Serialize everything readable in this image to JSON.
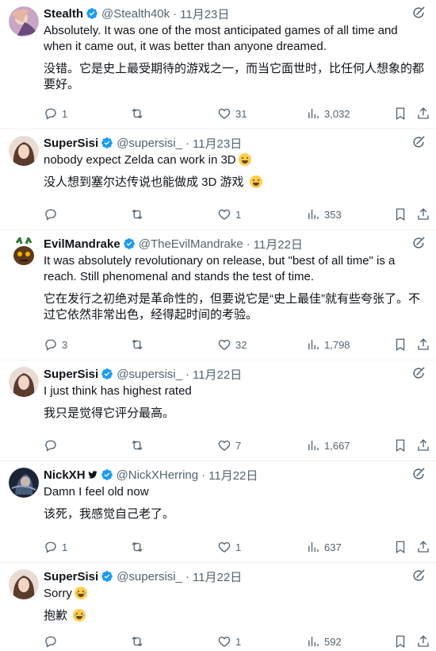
{
  "tweets": [
    {
      "name": "Stealth",
      "handle": "@Stealth40k",
      "time": "11月23日",
      "text_en": "Absolutely. It was one of the most anticipated games of all time and when it came out, it was better than anyone dreamed.",
      "text_zh": "没错。它是史上最受期待的游戏之一，而当它面世时，比任何人想象的都要好。",
      "replies": "1",
      "reposts": "",
      "likes": "31",
      "views": "3,032",
      "avatar_color": "#6a4a7a"
    },
    {
      "name": "SuperSisi",
      "handle": "@supersisi_",
      "time": "11月23日",
      "text_en": "nobody expect Zelda can work  in 3D",
      "text_zh": "没人想到塞尔达传说也能做成 3D 游戏",
      "replies": "",
      "reposts": "",
      "likes": "1",
      "views": "353",
      "avatar_color": "#6b4c3b"
    },
    {
      "name": "EvilMandrake",
      "handle": "@TheEvilMandrake",
      "time": "11月22日",
      "text_en": "It was absolutely revolutionary on release, but \"best of all time\" is a reach. Still phenomenal and stands the test of time.",
      "text_zh": "它在发行之初绝对是革命性的，但要说它是“史上最佳”就有些夸张了。不过它依然非常出色，经得起时间的考验。",
      "replies": "3",
      "reposts": "",
      "likes": "32",
      "views": "1,798",
      "avatar_color": "#5a3a1a"
    },
    {
      "name": "SuperSisi",
      "handle": "@supersisi_",
      "time": "11月22日",
      "text_en": "I just think  has highest rated",
      "text_zh": "我只是觉得它评分最高。",
      "replies": "",
      "reposts": "",
      "likes": "7",
      "views": "1,667",
      "avatar_color": "#6b4c3b"
    },
    {
      "name": "NickXH",
      "handle": "@NickXHerring",
      "time": "11月22日",
      "text_en": "Damn I feel old now",
      "text_zh": "该死，我感觉自己老了。",
      "replies": "1",
      "reposts": "",
      "likes": "1",
      "views": "637",
      "avatar_color": "#2a3a5a"
    },
    {
      "name": "SuperSisi",
      "handle": "@supersisi_",
      "time": "11月22日",
      "text_en": "Sorry",
      "text_zh": "抱歉",
      "replies": "",
      "reposts": "",
      "likes": "1",
      "views": "592",
      "avatar_color": "#6b4c3b"
    }
  ],
  "colors": {
    "verified": "#1d9bf0",
    "secondary_text": "#536471",
    "primary_text": "#0f1419",
    "divider": "#eff3f4"
  }
}
